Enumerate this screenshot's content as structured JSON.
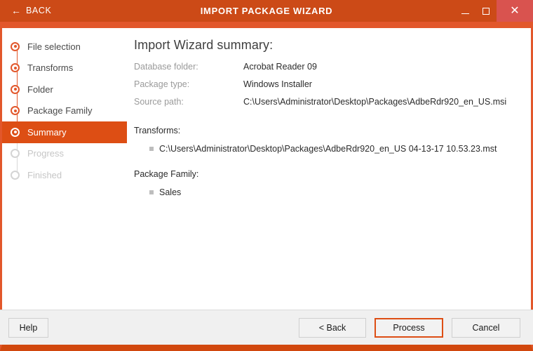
{
  "window": {
    "title": "IMPORT PACKAGE WIZARD",
    "back_label": "BACK",
    "back_icon": "arrow-left-icon",
    "minimize_icon": "minimize-icon",
    "maximize_icon": "maximize-icon",
    "close_icon": "close-icon",
    "accent_color": "#DD4E14",
    "titlebar_color": "#CC4A17",
    "close_button_color": "#D9534F"
  },
  "sidebar": {
    "steps": [
      {
        "label": "File selection",
        "state": "done"
      },
      {
        "label": "Transforms",
        "state": "done"
      },
      {
        "label": "Folder",
        "state": "done"
      },
      {
        "label": "Package Family",
        "state": "done"
      },
      {
        "label": "Summary",
        "state": "active"
      },
      {
        "label": "Progress",
        "state": "pending"
      },
      {
        "label": "Finished",
        "state": "pending"
      }
    ]
  },
  "main": {
    "title": "Import Wizard summary:",
    "details": [
      {
        "label": "Database folder:",
        "value": "Acrobat Reader 09"
      },
      {
        "label": "Package type:",
        "value": "Windows Installer"
      },
      {
        "label": "Source path:",
        "value": "C:\\Users\\Administrator\\Desktop\\Packages\\AdbeRdr920_en_US.msi"
      }
    ],
    "transforms": {
      "title": "Transforms:",
      "items": [
        "C:\\Users\\Administrator\\Desktop\\Packages\\AdbeRdr920_en_US 04-13-17 10.53.23.mst"
      ]
    },
    "package_family": {
      "title": "Package Family:",
      "items": [
        "Sales"
      ]
    }
  },
  "footer": {
    "help_label": "Help",
    "back_label": "< Back",
    "process_label": "Process",
    "cancel_label": "Cancel"
  }
}
